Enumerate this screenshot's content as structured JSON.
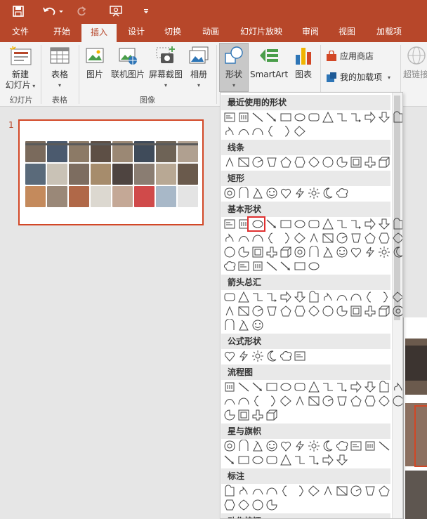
{
  "colors": {
    "accent": "#b7472a",
    "selection": "#e03030"
  },
  "quick_access": [
    "save-icon",
    "undo-icon",
    "redo-icon",
    "present-icon",
    "customize-icon"
  ],
  "tabs": [
    "文件",
    "开始",
    "插入",
    "设计",
    "切换",
    "动画",
    "幻灯片放映",
    "审阅",
    "视图",
    "加载项"
  ],
  "active_tab": "插入",
  "ribbon": {
    "new_slide": {
      "line1": "新建",
      "line2": "幻灯片"
    },
    "table": "表格",
    "picture": "图片",
    "online_picture": "联机图片",
    "screenshot": "屏幕截图",
    "album": "相册",
    "shapes": "形状",
    "smartart": "SmartArt",
    "chart": "图表",
    "store": "应用商店",
    "my_addins": "我的加载项",
    "hyperlink": "超链接",
    "groups": {
      "slides": "幻灯片",
      "tables": "表格",
      "images": "图像"
    }
  },
  "slide_pane": {
    "slide_number": "1"
  },
  "shapes_menu": {
    "sections": [
      "最近使用的形状",
      "线条",
      "矩形",
      "基本形状",
      "箭头总汇",
      "公式形状",
      "流程图",
      "星与旗帜",
      "标注",
      "动作按钮"
    ],
    "selected_shape": "oval"
  }
}
